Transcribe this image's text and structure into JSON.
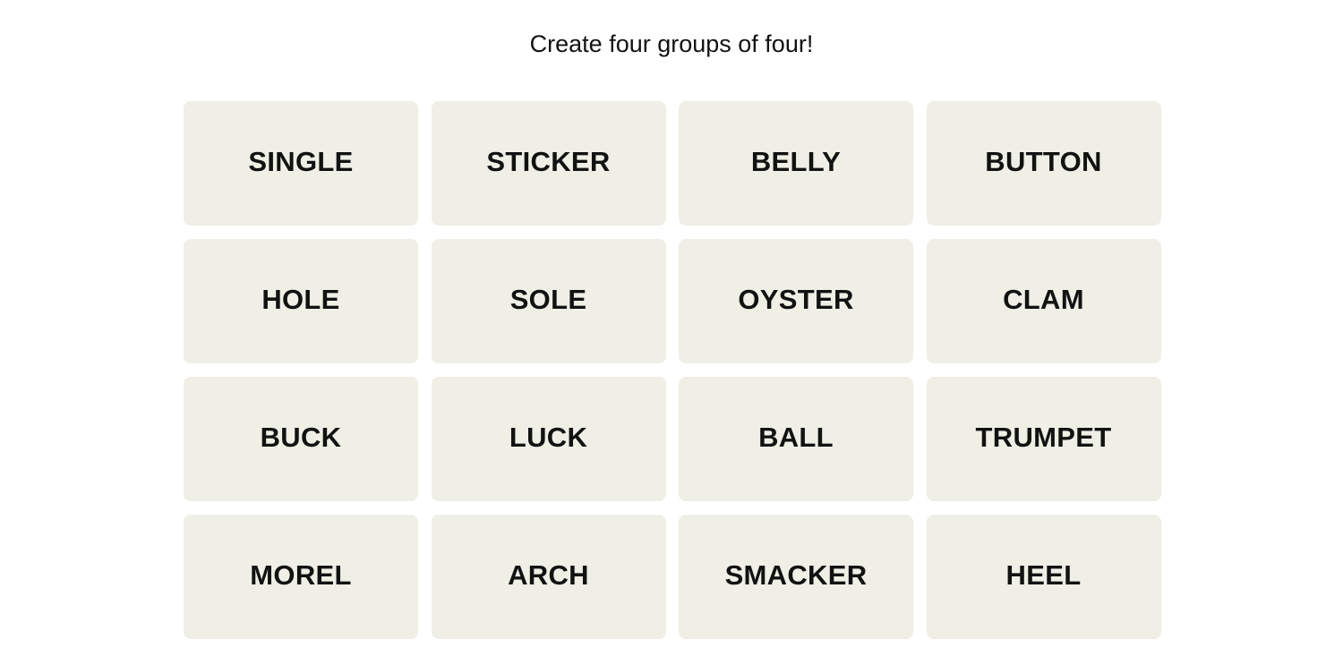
{
  "instructions": "Create four groups of four!",
  "tiles": [
    "SINGLE",
    "STICKER",
    "BELLY",
    "BUTTON",
    "HOLE",
    "SOLE",
    "OYSTER",
    "CLAM",
    "BUCK",
    "LUCK",
    "BALL",
    "TRUMPET",
    "MOREL",
    "ARCH",
    "SMACKER",
    "HEEL"
  ],
  "colors": {
    "tile_bg": "#efefe6",
    "text": "#121212"
  }
}
